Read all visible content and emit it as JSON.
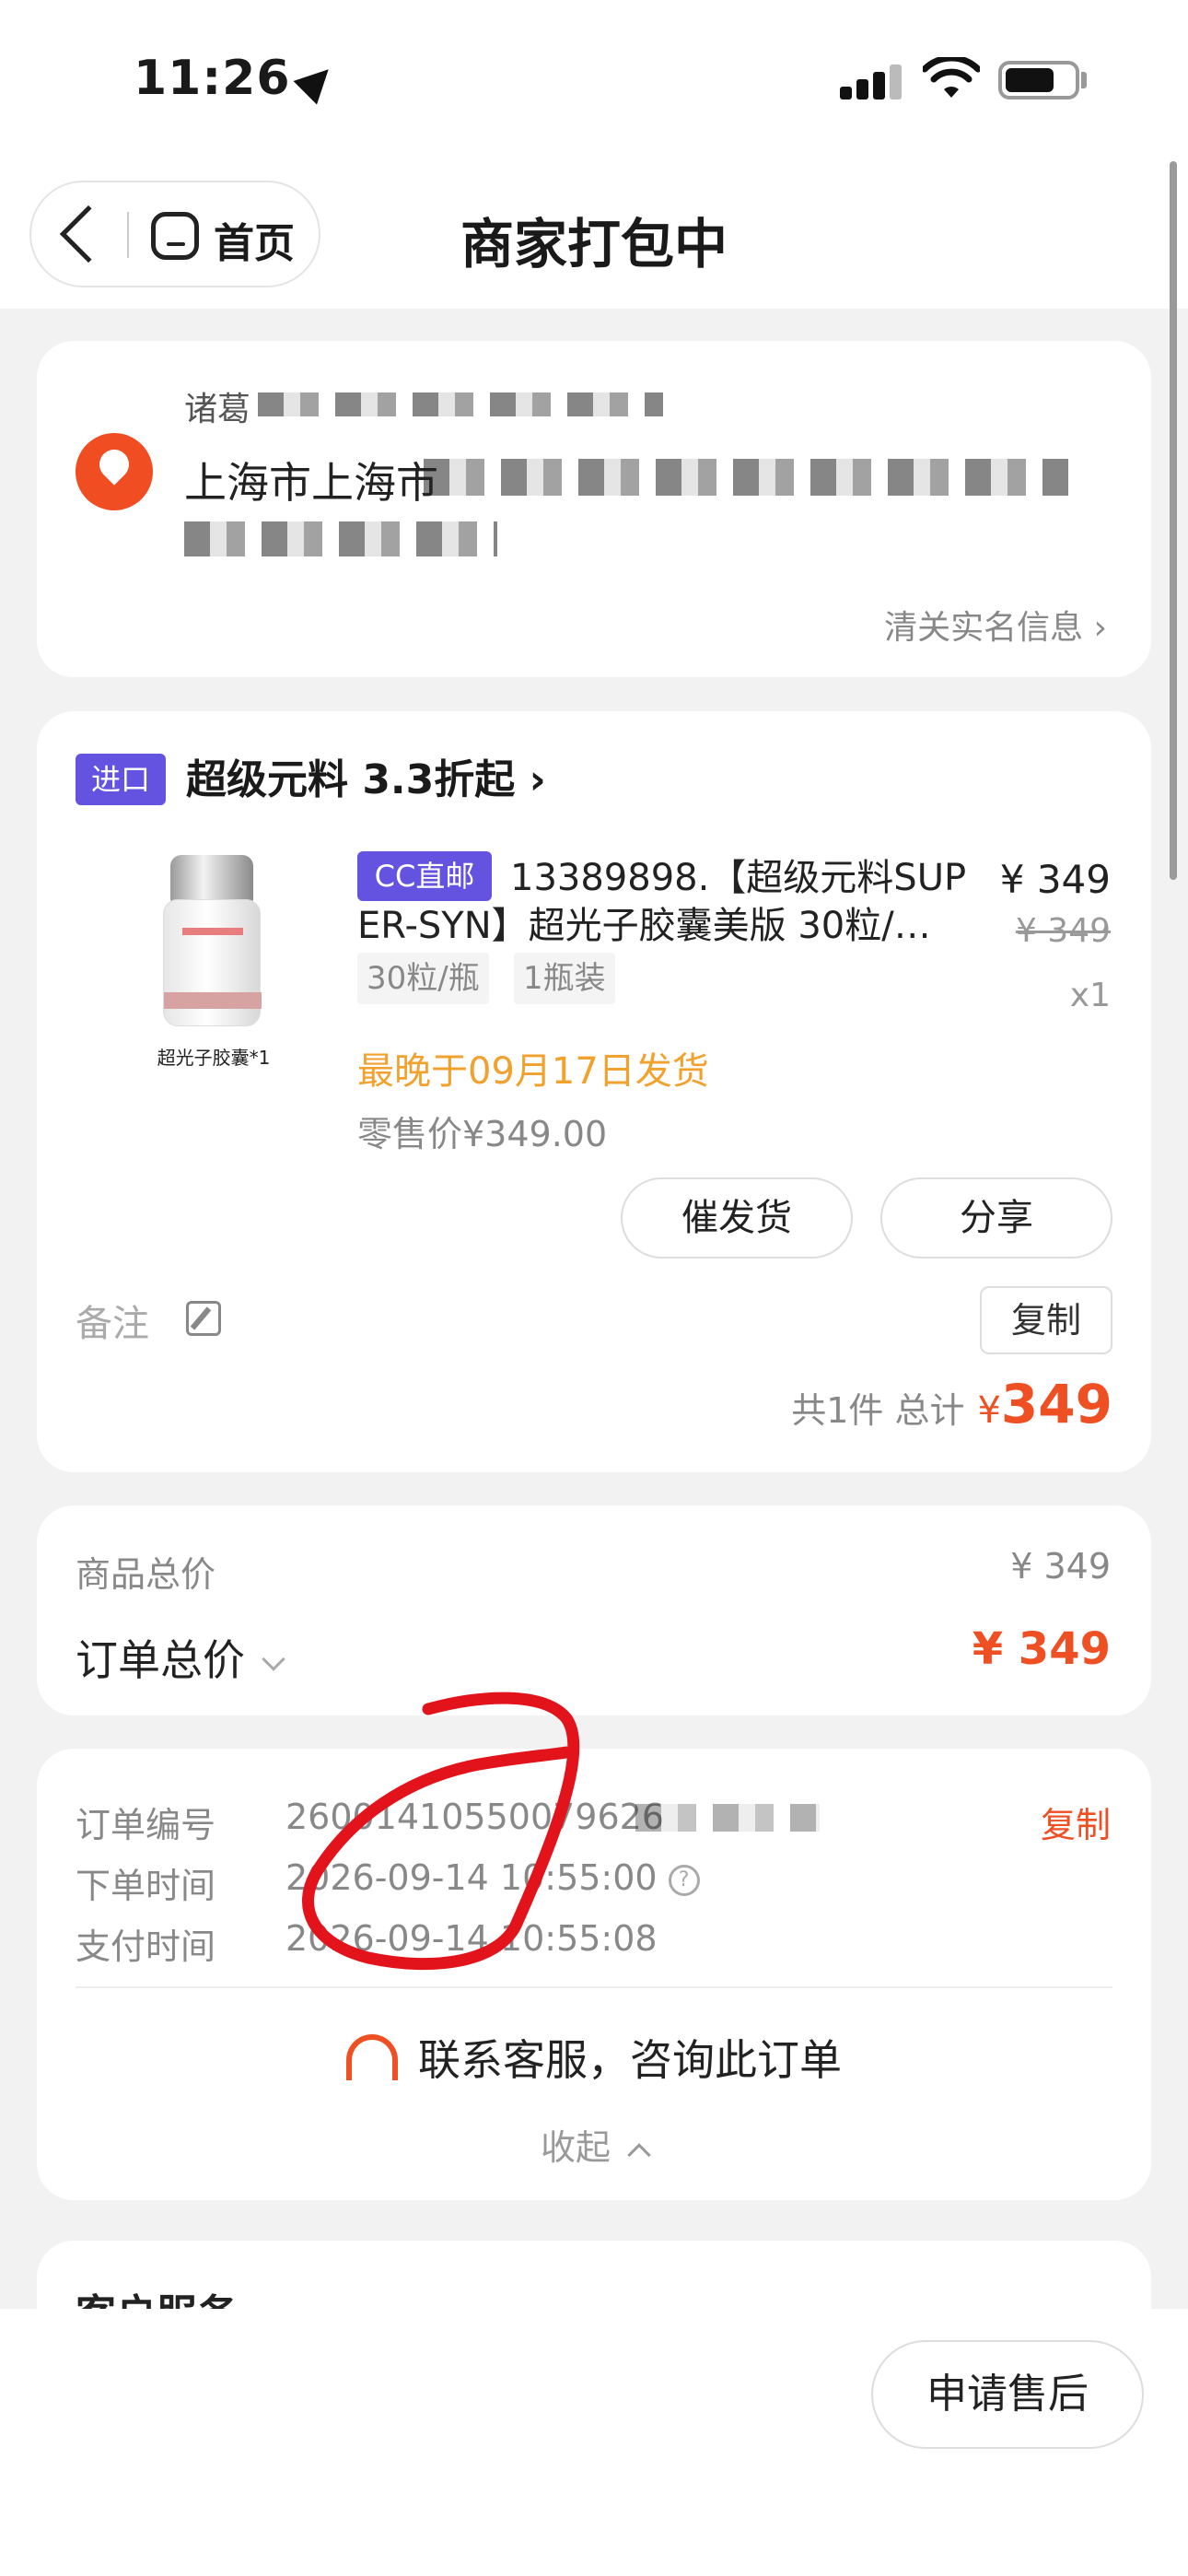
{
  "status_bar": {
    "time": "11:26"
  },
  "nav": {
    "home_label": "首页",
    "title": "商家打包中"
  },
  "address": {
    "name": "诸葛",
    "line": "上海市上海市",
    "line2": "",
    "customs_link": "清关实名信息 ›"
  },
  "store": {
    "tag": "进口",
    "name": "超级元料 3.3折起 ›"
  },
  "product": {
    "thumb_caption": "超光子胶囊*1",
    "cc_tag": "CC直邮",
    "title_line1": "13389898.【超级元料SUP",
    "title_line2": "ER-SYN】超光子胶囊美版 30粒/…",
    "price": "¥ 349",
    "orig_price": "¥ 349",
    "qty": "x1",
    "specs": [
      "30粒/瓶",
      "1瓶装"
    ],
    "ship_note": "最晚于09月17日发货",
    "retail_price": "零售价¥349.00",
    "btn_urge": "催发货",
    "btn_share": "分享"
  },
  "remark": {
    "label": "备注",
    "copy": "复制"
  },
  "totals": {
    "count_label": "共1件 总计",
    "yen": "¥",
    "amount": "349"
  },
  "summary": {
    "goods_total_label": "商品总价",
    "goods_total_val": "¥ 349",
    "order_total_label": "订单总价",
    "order_total_val": "¥ 349"
  },
  "order_info": {
    "order_no_label": "订单编号",
    "order_no": "26001410550079626",
    "copy": "复制",
    "order_time_label": "下单时间",
    "order_time": "2026-09-14 10:55:00",
    "pay_time_label": "支付时间",
    "pay_time": "2026-09-14 10:55:08",
    "contact": "联系客服，咨询此订单",
    "collapse": "收起"
  },
  "service": {
    "title": "客户服务"
  },
  "bottom": {
    "after_sale": "申请售后"
  },
  "colors": {
    "accent": "#ee4f23",
    "tag_purple": "#6353e0",
    "ship_orange": "#f1a22e"
  }
}
